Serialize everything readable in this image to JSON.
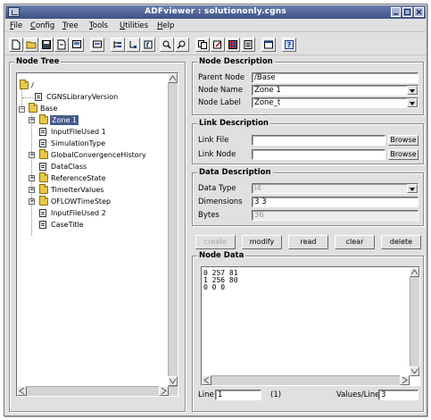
{
  "window": {
    "title": "ADFviewer : solutiononly.cgns",
    "buttons": [
      "minimize",
      "maximize",
      "close"
    ]
  },
  "menu": [
    "File",
    "Config",
    "Tree",
    "Tools",
    "Utilities",
    "Help"
  ],
  "toolbar": {
    "icons": [
      "new-file-icon",
      "open-folder-icon",
      "save-icon",
      "refresh-icon",
      "print-icon",
      "zoom-icon",
      "tree-expand-icon",
      "tree-link-icon",
      "node-icon",
      "search-icon",
      "search-replace-icon",
      "copy-icon",
      "edit-icon",
      "grid-icon",
      "calculator-icon",
      "window-icon",
      "help-icon"
    ]
  },
  "tree": {
    "title": "Node Tree",
    "nodes": [
      {
        "label": "/",
        "type": "folder",
        "selected": false
      },
      {
        "label": "CGNSLibraryVersion",
        "type": "doc",
        "selected": false
      },
      {
        "label": "Base",
        "type": "folder",
        "selected": false
      },
      {
        "label": "Zone   1",
        "type": "folder",
        "selected": true
      },
      {
        "label": "InputFileUsed 1",
        "type": "doc",
        "selected": false
      },
      {
        "label": "SimulationType",
        "type": "doc",
        "selected": false
      },
      {
        "label": "GlobalConvergenceHistory",
        "type": "folder",
        "selected": false
      },
      {
        "label": "DataClass",
        "type": "doc",
        "selected": false
      },
      {
        "label": "ReferenceState",
        "type": "folder",
        "selected": false
      },
      {
        "label": "TimeIterValues",
        "type": "folder",
        "selected": false
      },
      {
        "label": "OFLOWTimeStep",
        "type": "folder",
        "selected": false
      },
      {
        "label": "InputFileUsed 2",
        "type": "doc",
        "selected": false
      },
      {
        "label": "CaseTitle",
        "type": "doc",
        "selected": false
      }
    ]
  },
  "node_description": {
    "title": "Node Description",
    "parent_node_label": "Parent Node",
    "parent_node_value": "/Base",
    "node_name_label": "Node Name",
    "node_name_value": "Zone   1",
    "node_label_label": "Node Label",
    "node_label_value": "Zone_t"
  },
  "link_description": {
    "title": "Link Description",
    "link_file_label": "Link File",
    "link_file_value": "",
    "link_node_label": "Link Node",
    "link_node_value": "",
    "browse_label": "Browse"
  },
  "data_description": {
    "title": "Data Description",
    "data_type_label": "Data Type",
    "data_type_value": "I4",
    "dimensions_label": "Dimensions",
    "dimensions_value": "3 3",
    "bytes_label": "Bytes",
    "bytes_value": "36"
  },
  "actions": {
    "create": "create",
    "modify": "modify",
    "read": "read",
    "clear": "clear",
    "delete": "delete"
  },
  "node_data": {
    "title": "Node Data",
    "lines": [
      "0 257 81",
      "1 256 80",
      "0 0 0"
    ],
    "line_label": "Line",
    "line_value": "1",
    "line_count": "(1)",
    "values_per_line_label": "Values/Line",
    "values_per_line_value": "3"
  }
}
